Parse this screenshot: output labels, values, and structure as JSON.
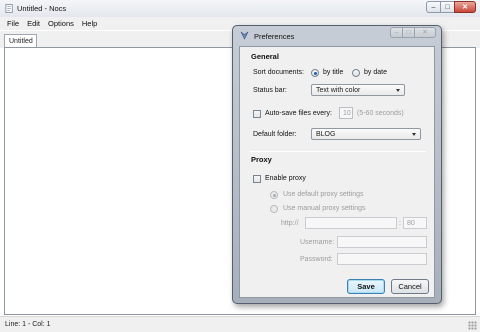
{
  "window": {
    "title": "Untitled - Nocs",
    "controls": {
      "minimize": "–",
      "maximize": "□",
      "close": "✕"
    }
  },
  "menu": [
    "File",
    "Edit",
    "Options",
    "Help"
  ],
  "tabs": [
    {
      "label": "Untitled"
    }
  ],
  "editor": {
    "text": ""
  },
  "status": {
    "text": "Line: 1 - Col: 1"
  },
  "dialog": {
    "title": "Preferences",
    "general": {
      "heading": "General",
      "sort_label": "Sort documents:",
      "sort_options": [
        "by title",
        "by date"
      ],
      "sort_selected": "by title",
      "statusbar_label": "Status bar:",
      "statusbar_value": "Text with color",
      "autosave_label": "Auto-save files every:",
      "autosave_checked": false,
      "autosave_value": "10",
      "autosave_hint": "(5-60 seconds)",
      "folder_label": "Default folder:",
      "folder_value": "BLOG"
    },
    "proxy": {
      "heading": "Proxy",
      "enable_label": "Enable proxy",
      "enable_checked": false,
      "default_option": "Use default proxy settings",
      "manual_option": "Use manual proxy settings",
      "selected": "Use default proxy settings",
      "host_prefix": "http://",
      "host_value": "",
      "port_prefix": ":",
      "port_value": "80",
      "username_label": "Username:",
      "username_value": "",
      "password_label": "Password:",
      "password_value": ""
    },
    "buttons": {
      "save": "Save",
      "cancel": "Cancel"
    }
  },
  "colors": {
    "default_button": "#c9e6f8",
    "close_button": "#c9473a",
    "dialog_frame": "#a7afbb"
  },
  "icons": [
    "app-icon",
    "minimize-icon",
    "maximize-icon",
    "close-icon",
    "preferences-icon",
    "resize-grip-icon",
    "dropdown-arrow-icon"
  ]
}
